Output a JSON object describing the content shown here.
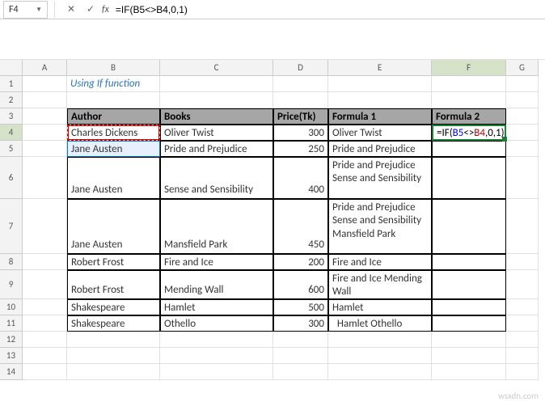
{
  "formula_bar": {
    "name_box": "F4",
    "cancel": "✕",
    "enter": "✓",
    "fx": "fx",
    "formula": "=IF(B5<>B4,0,1)"
  },
  "columns": [
    "A",
    "B",
    "C",
    "D",
    "E",
    "F",
    "G"
  ],
  "rows": [
    "1",
    "2",
    "3",
    "4",
    "5",
    "6",
    "7",
    "8",
    "9",
    "10",
    "11",
    "12",
    "13",
    "14"
  ],
  "title": "Using If function",
  "headers": {
    "B": "Author",
    "C": "Books",
    "D": "Price(Tk)",
    "E": "Formula 1",
    "F": "Formula 2"
  },
  "data": [
    {
      "author": "Charles Dickens",
      "book": "Oliver Twist",
      "price": "300",
      "f1": "Oliver Twist"
    },
    {
      "author": "Jane Austen",
      "book": "Pride and Prejudice",
      "price": "250",
      "f1": "Pride and Prejudice"
    },
    {
      "author": "Jane Austen",
      "book": "Sense and Sensibility",
      "price": "400",
      "f1": "Pride and Prejudice Sense and Sensibility"
    },
    {
      "author": "Jane Austen",
      "book": "Mansfield Park",
      "price": "450",
      "f1": "Pride and Prejudice Sense and Sensibility Mansfield Park"
    },
    {
      "author": "Robert Frost",
      "book": "Fire and Ice",
      "price": "200",
      "f1": "Fire and Ice"
    },
    {
      "author": "Robert Frost",
      "book": "Mending Wall",
      "price": "600",
      "f1": "Fire and Ice Mending Wall"
    },
    {
      "author": "Shakespeare",
      "book": "Hamlet",
      "price": "500",
      "f1": "Hamlet"
    },
    {
      "author": "Shakespeare",
      "book": "Othello",
      "price": "300",
      "f1": "  Hamlet Othello"
    }
  ],
  "active_formula": {
    "prefix": "=IF(",
    "ref1": "B5",
    "op": "<>",
    "ref2": "B4",
    "suffix": ",0,1)"
  },
  "watermark": "wsxdn.com"
}
